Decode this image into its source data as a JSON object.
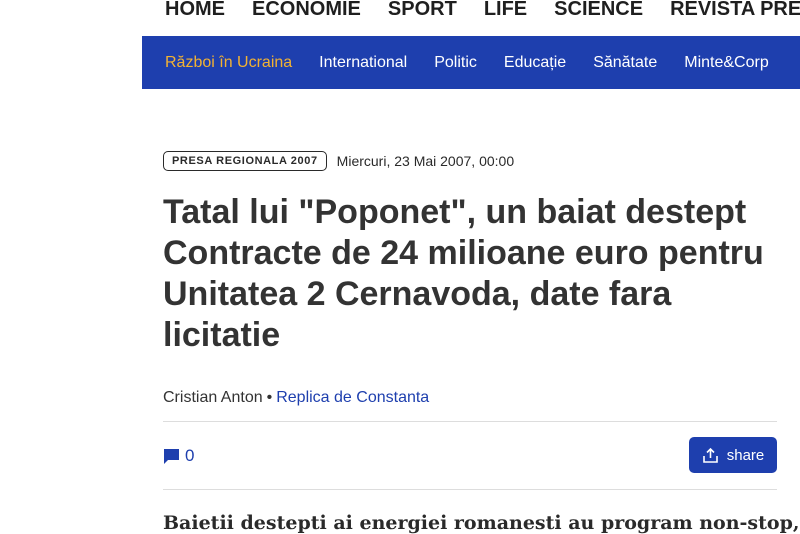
{
  "top_nav": [
    "HOME",
    "ECONOMIE",
    "SPORT",
    "LIFE",
    "SCIENCE",
    "REVISTA PRESEI"
  ],
  "categories": [
    "Război în Ucraina",
    "International",
    "Politic",
    "Educație",
    "Sănătate",
    "Minte&Corp"
  ],
  "colors": {
    "brand_blue": "#1e3fae",
    "highlight_category": "#f2b233"
  },
  "article": {
    "badge": "PRESA REGIONALA 2007",
    "date": "Miercuri, 23 Mai 2007, 00:00",
    "title": "Tatal lui \"Poponet\", un baiat destept Contracte de 24 milioane euro pentru Unitatea 2 Cernavoda, date fara licitatie",
    "author": "Cristian Anton",
    "separator": "•",
    "source": "Replica de Constanta",
    "comment_count": "0",
    "comment_icon": "speech-bubble-icon",
    "share_label": "share",
    "share_icon": "upload-share-icon",
    "lead_text": "Baietii destepti ai energiei romanesti au program non-stop, iar"
  }
}
